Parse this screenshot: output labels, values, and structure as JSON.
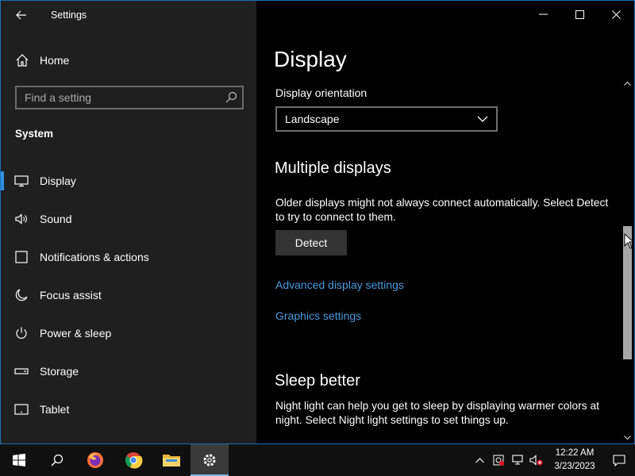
{
  "window": {
    "title": "Settings"
  },
  "sidebar": {
    "home_label": "Home",
    "search_placeholder": "Find a setting",
    "section": "System",
    "items": [
      {
        "label": "Display",
        "icon": "monitor-icon",
        "active": true
      },
      {
        "label": "Sound",
        "icon": "speaker-icon"
      },
      {
        "label": "Notifications & actions",
        "icon": "notification-icon"
      },
      {
        "label": "Focus assist",
        "icon": "moon-icon"
      },
      {
        "label": "Power & sleep",
        "icon": "power-icon"
      },
      {
        "label": "Storage",
        "icon": "storage-icon"
      },
      {
        "label": "Tablet",
        "icon": "tablet-icon"
      }
    ]
  },
  "main": {
    "title": "Display",
    "orientation_label": "Display orientation",
    "orientation_value": "Landscape",
    "multiple_heading": "Multiple displays",
    "multiple_desc": "Older displays might not always connect automatically. Select Detect to try to connect to them.",
    "detect_label": "Detect",
    "advanced_link": "Advanced display settings",
    "graphics_link": "Graphics settings",
    "sleep_heading": "Sleep better",
    "sleep_desc": "Night light can help you get to sleep by displaying warmer colors at night. Select Night light settings to set things up."
  },
  "taskbar": {
    "apps": [
      "start-icon",
      "search-icon",
      "firefox-icon",
      "chrome-icon",
      "file-explorer-icon",
      "settings-icon"
    ],
    "time": "12:22 AM",
    "date": "3/23/2023"
  },
  "colors": {
    "accent": "#2f8fe0",
    "link": "#4a9be0",
    "sidebar_bg": "#1f1f1f",
    "main_bg": "#000000",
    "taskbar_bg": "#101010"
  }
}
